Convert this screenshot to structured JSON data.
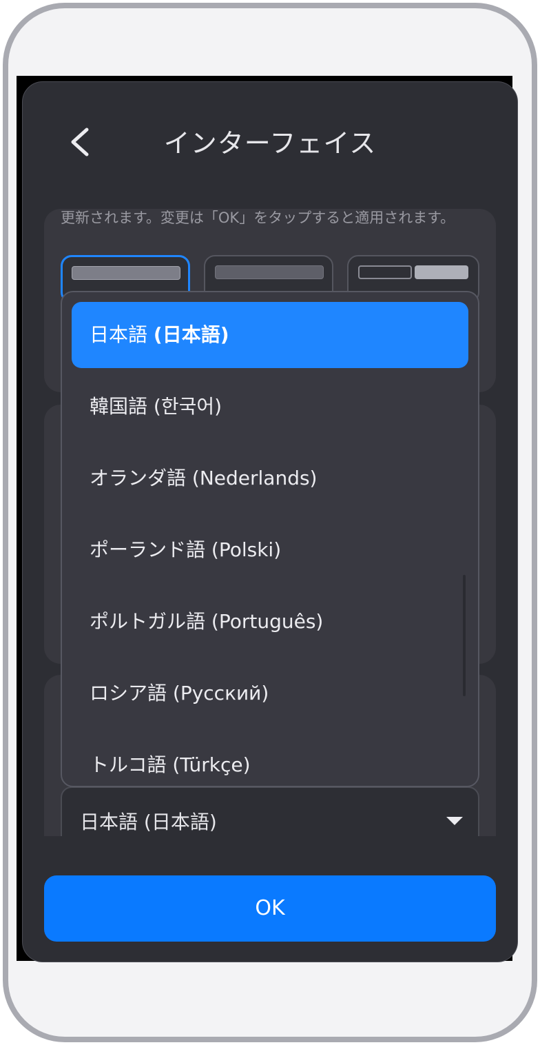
{
  "header": {
    "back_icon": "chevron-left-icon",
    "title": "インターフェイス"
  },
  "section": {
    "description": "更新されます。変更は「OK」をタップすると適用されます。"
  },
  "language_select": {
    "value": "日本語 (日本語)",
    "caret_icon": "caret-down-icon",
    "options": [
      {
        "label_main": "日本語 ",
        "label_paren": "(日本語)",
        "selected": true
      },
      {
        "label_main": "韓国語 (한국어)",
        "selected": false
      },
      {
        "label_main": "オランダ語 (Nederlands)",
        "selected": false
      },
      {
        "label_main": "ポーランド語 (Polski)",
        "selected": false
      },
      {
        "label_main": "ポルトガル語 (Português)",
        "selected": false
      },
      {
        "label_main": "ロシア語 (Русский)",
        "selected": false
      },
      {
        "label_main": "トルコ語 (Türkçe)",
        "selected": false
      }
    ]
  },
  "footer": {
    "ok_label": "OK"
  },
  "colors": {
    "accent": "#1f86ff",
    "ok_button": "#0a7aff",
    "panel_bg": "#2d2e34",
    "dropdown_bg": "#393941"
  }
}
